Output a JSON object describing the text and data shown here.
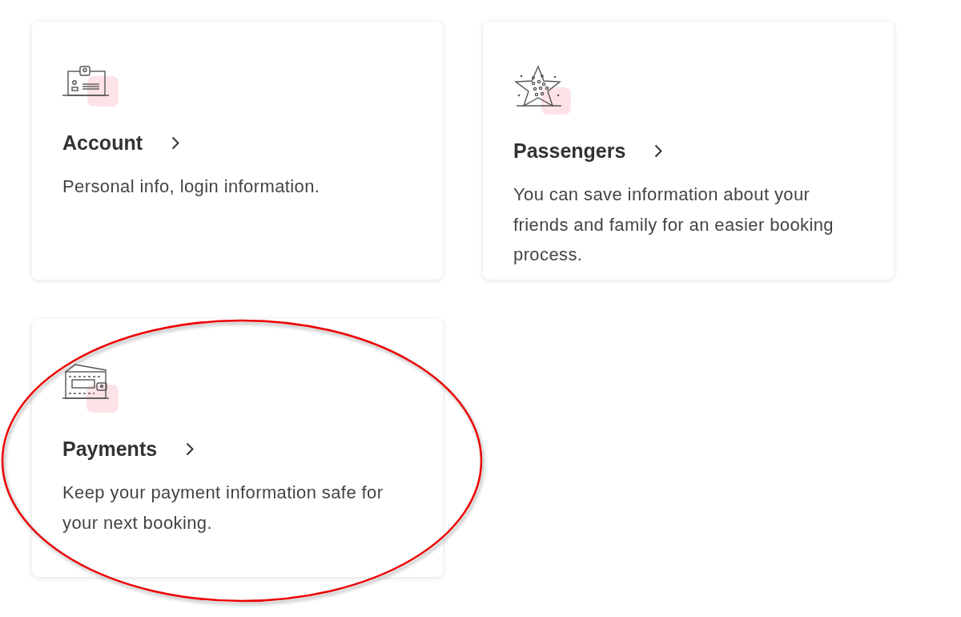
{
  "cards": [
    {
      "kind": "account",
      "title": "Account",
      "description": "Personal info, login information.",
      "circled": false
    },
    {
      "kind": "passengers",
      "title": "Passengers",
      "description": "You can save information about your friends and family for an easier booking process.",
      "circled": false
    },
    {
      "kind": "payments",
      "title": "Payments",
      "description": "Keep your payment information safe for your next booking.",
      "circled": true
    }
  ]
}
